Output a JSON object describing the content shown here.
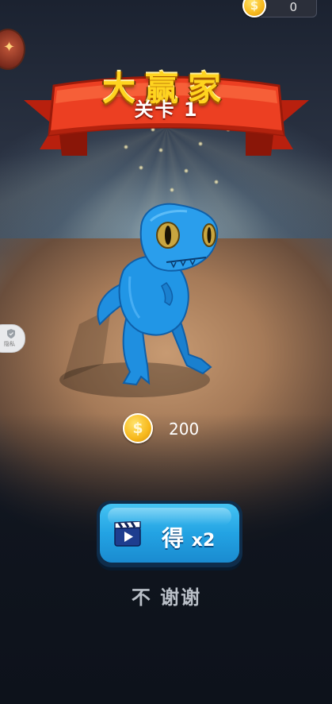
{
  "header": {
    "coin_balance": "0"
  },
  "banner": {
    "title": "大赢家",
    "level": "关卡 1"
  },
  "side": {
    "privacy_label": "隐私"
  },
  "reward": {
    "amount": "200"
  },
  "actions": {
    "multiply_label": "得",
    "multiply_factor": "x2",
    "decline_label": "不 谢谢"
  },
  "icons": {
    "coin": "coin-icon",
    "video": "video-ad-icon",
    "chest": "chest-icon",
    "shield": "shield-icon"
  },
  "colors": {
    "banner_red": "#e2331c",
    "title_gold": "#ffd41f",
    "button_blue": "#23a3e3",
    "dino_blue": "#1f8fe0"
  }
}
